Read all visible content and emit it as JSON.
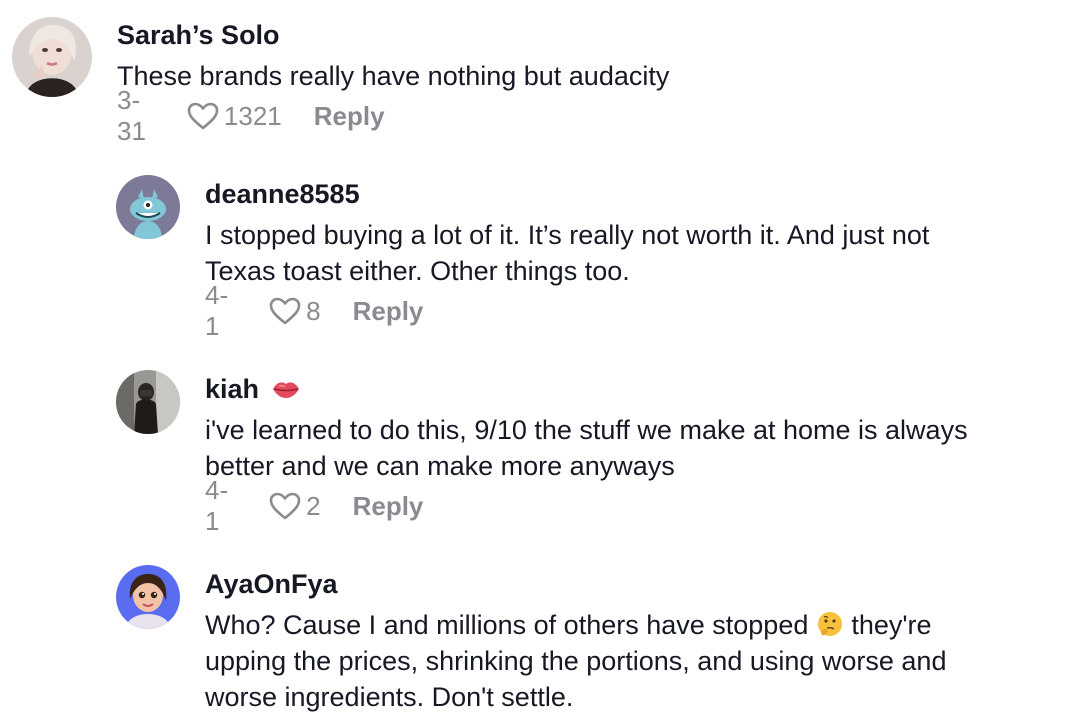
{
  "comments": [
    {
      "username": "Sarah’s Solo",
      "text_lines": [
        "These brands really have nothing but audacity"
      ],
      "date": "3-31",
      "likes": "1321",
      "reply_label": "Reply"
    },
    {
      "username": "deanne8585",
      "text_lines": [
        "I stopped buying a lot of it. It’s really not worth it. And just not",
        "Texas toast either. Other things too."
      ],
      "date": "4-1",
      "likes": "8",
      "reply_label": "Reply"
    },
    {
      "username": "kiah",
      "username_icon": "lips-emoji",
      "text_lines": [
        "i've learned to do this, 9/10 the stuff we make at home is always",
        "better and we can make more anyways"
      ],
      "date": "4-1",
      "likes": "2",
      "reply_label": "Reply"
    },
    {
      "username": "AyaOnFya",
      "text_line1_part1": "Who? Cause I and millions of others have stopped ",
      "text_line1_emoji": "thinking-face-emoji",
      "text_line1_part2": " they're",
      "text_lines_rest": [
        "upping the prices, shrinking the portions, and using worse and",
        "worse ingredients. Don't settle."
      ]
    }
  ],
  "colors": {
    "text": "#161823",
    "meta": "#8a8b91"
  }
}
